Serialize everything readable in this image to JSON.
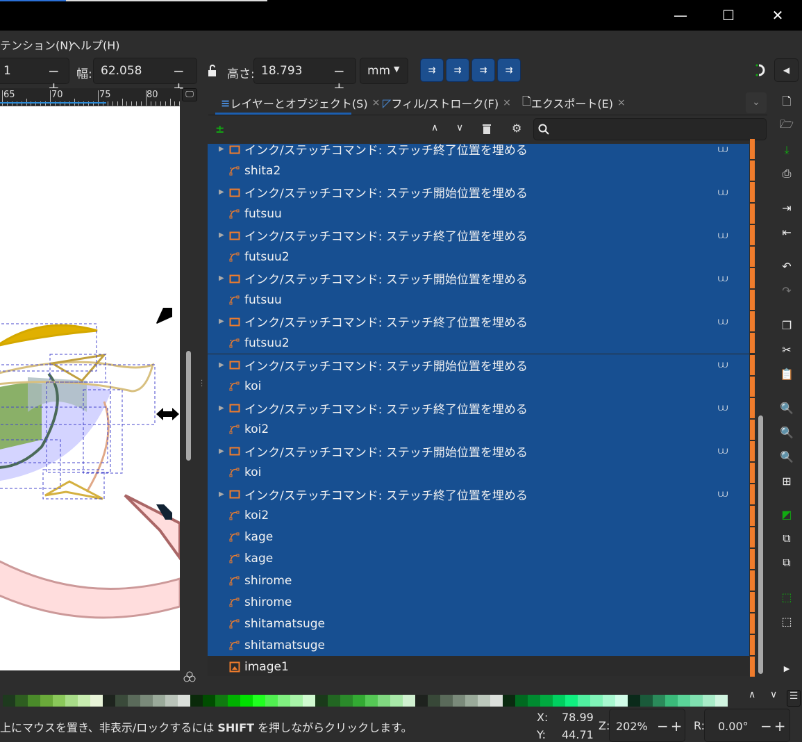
{
  "window": {
    "minimize": "—",
    "maximize": "☐",
    "close": "✕"
  },
  "menu": {
    "items": [
      "テンション(N)",
      "ヘルプ(H)"
    ]
  },
  "toolbar": {
    "x_value": "1",
    "w_label": "幅:",
    "w_value": "62.058",
    "h_label": "高さ:",
    "h_value": "18.793",
    "unit": "mm",
    "minus": "−",
    "plus": "+",
    "lock_icon": "lock-open-icon",
    "transform_buttons": [
      "scale-stroke",
      "scale-corners",
      "transform-gradients",
      "transform-patterns"
    ]
  },
  "ruler": {
    "labels": [
      "65",
      "70",
      "75",
      "80"
    ]
  },
  "panel": {
    "tabs": [
      {
        "label": "レイヤーとオブジェクト(S)",
        "icon": "layers-icon",
        "active": true
      },
      {
        "label": "フィル/ストローク(F)",
        "icon": "fill-stroke-icon"
      },
      {
        "label": "エクスポート(E)",
        "icon": "export-icon"
      }
    ],
    "tab_close": "×",
    "rows": [
      {
        "type": "group",
        "label": "インク/ステッチコマンド: ステッチ終了位置を埋める",
        "selected": true
      },
      {
        "type": "path",
        "label": "shita2",
        "selected": true
      },
      {
        "type": "group",
        "label": "インク/ステッチコマンド: ステッチ開始位置を埋める",
        "selected": true
      },
      {
        "type": "path",
        "label": "futsuu",
        "selected": true
      },
      {
        "type": "group",
        "label": "インク/ステッチコマンド: ステッチ終了位置を埋める",
        "selected": true
      },
      {
        "type": "path",
        "label": "futsuu2",
        "selected": true
      },
      {
        "type": "group",
        "label": "インク/ステッチコマンド: ステッチ開始位置を埋める",
        "selected": true
      },
      {
        "type": "path",
        "label": "futsuu",
        "selected": true
      },
      {
        "type": "group",
        "label": "インク/ステッチコマンド: ステッチ終了位置を埋める",
        "selected": true
      },
      {
        "type": "path",
        "label": "futsuu2",
        "selected": true
      },
      {
        "type": "group",
        "label": "インク/ステッチコマンド: ステッチ開始位置を埋める",
        "selected": true
      },
      {
        "type": "path",
        "label": "koi",
        "selected": true
      },
      {
        "type": "group",
        "label": "インク/ステッチコマンド: ステッチ終了位置を埋める",
        "selected": true
      },
      {
        "type": "path",
        "label": "koi2",
        "selected": true
      },
      {
        "type": "group",
        "label": "インク/ステッチコマンド: ステッチ開始位置を埋める",
        "selected": true
      },
      {
        "type": "path",
        "label": "koi",
        "selected": true
      },
      {
        "type": "group",
        "label": "インク/ステッチコマンド: ステッチ終了位置を埋める",
        "selected": true
      },
      {
        "type": "path",
        "label": "koi2",
        "selected": true
      },
      {
        "type": "path",
        "label": "kage",
        "selected": true
      },
      {
        "type": "path",
        "label": "kage",
        "selected": true
      },
      {
        "type": "path",
        "label": "shirome",
        "selected": true
      },
      {
        "type": "path",
        "label": "shirome",
        "selected": true
      },
      {
        "type": "path",
        "label": "shitamatsuge",
        "selected": true
      },
      {
        "type": "path",
        "label": "shitamatsuge",
        "selected": true
      },
      {
        "type": "image",
        "label": "image1",
        "selected": false
      }
    ]
  },
  "palette": [
    "#1e3a1e",
    "#2e5e20",
    "#4a8a2a",
    "#6aaa3a",
    "#8ac85a",
    "#a8dc88",
    "#c8ecb0",
    "#e8f4d8",
    "#1e241e",
    "#3a4a3a",
    "#5a6a5a",
    "#7a8a7a",
    "#9aaa9a",
    "#bac4ba",
    "#dadfda",
    "#0a2a0a",
    "#004d00",
    "#107a10",
    "#00b000",
    "#00e000",
    "#20ff20",
    "#50f050",
    "#80f080",
    "#a8f4a8",
    "#d0fad0",
    "#1a3a1a",
    "#226622",
    "#2a8a2a",
    "#33aa33",
    "#55c855",
    "#80d880",
    "#a8e8a8",
    "#d0f0d0",
    "#1e221e",
    "#384838",
    "#5a6a5a",
    "#7a8a7a",
    "#9aaa9a",
    "#bcc8bc",
    "#dce0dc",
    "#0a2a10",
    "#006a20",
    "#008a30",
    "#00aa40",
    "#00d060",
    "#10f080",
    "#50f0a0",
    "#80f4b8",
    "#a8f8d0",
    "#d0fce8",
    "#0a2a1a",
    "#1a5a3a",
    "#2a8a5a",
    "#3aba7a",
    "#5ad498",
    "#80e0b0",
    "#a8ecc8",
    "#d0f4e0"
  ],
  "status": {
    "message_pre": "上にマウスを置き、非表示/ロックするには ",
    "message_key": "SHIFT",
    "message_post": " を押しながらクリックします。",
    "x_label": "X:",
    "x_value": "78.99",
    "y_label": "Y:",
    "y_value": "44.71",
    "zoom_label": "Z:",
    "zoom_value": "202%",
    "rot_label": "R:",
    "rot_value": "0.00°"
  },
  "colors": {
    "selection": "#174f91",
    "accent_orange": "#f07c2c",
    "toolbar_blue": "#1c4f8f"
  }
}
